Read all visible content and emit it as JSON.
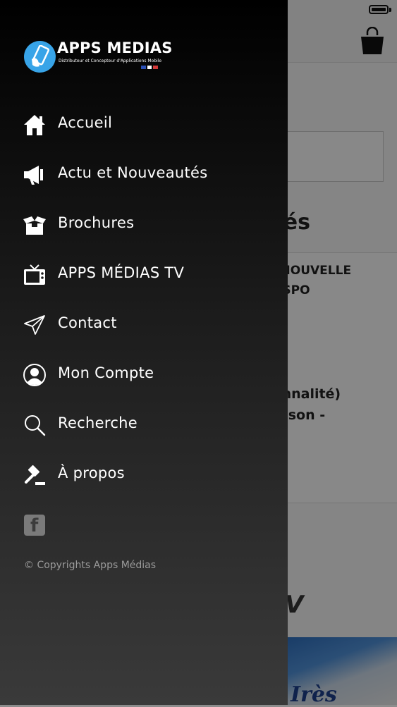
{
  "background": {
    "heading_fragment": "és",
    "card1_line1": "E NOUVELLE",
    "card1_line2": "DISPO",
    "card2_line1": "ionnalité)",
    "card2_line2": "raison -",
    "tv_fragment": "V",
    "photo_fragment": "Irès"
  },
  "drawer": {
    "logo": {
      "title": "APPS MEDIAS",
      "subtitle": "Distributeur et Concepteur d'Applications Mobile",
      "flag_colors": [
        "#2b4fb5",
        "#ffffff",
        "#d33a3a"
      ]
    },
    "menu": [
      {
        "label": "Accueil",
        "icon": "home-icon"
      },
      {
        "label": "Actu et Nouveautés",
        "icon": "megaphone-icon"
      },
      {
        "label": "Brochures",
        "icon": "open-box-icon"
      },
      {
        "label": "APPS MÉDIAS TV",
        "icon": "tv-icon"
      },
      {
        "label": "Contact",
        "icon": "paper-plane-icon"
      },
      {
        "label": "Mon Compte",
        "icon": "user-icon"
      },
      {
        "label": "Recherche",
        "icon": "search-icon"
      },
      {
        "label": "À propos",
        "icon": "gavel-icon"
      }
    ],
    "social": {
      "facebook_glyph": "f"
    },
    "copyright": "© Copyrights Apps Médias"
  },
  "colors": {
    "drawer_top": "#000000",
    "drawer_bottom": "#3a3a3a",
    "logo_blue": "#38a4e8",
    "menu_text": "#ffffff",
    "copyright_text": "#9a9a9a"
  }
}
